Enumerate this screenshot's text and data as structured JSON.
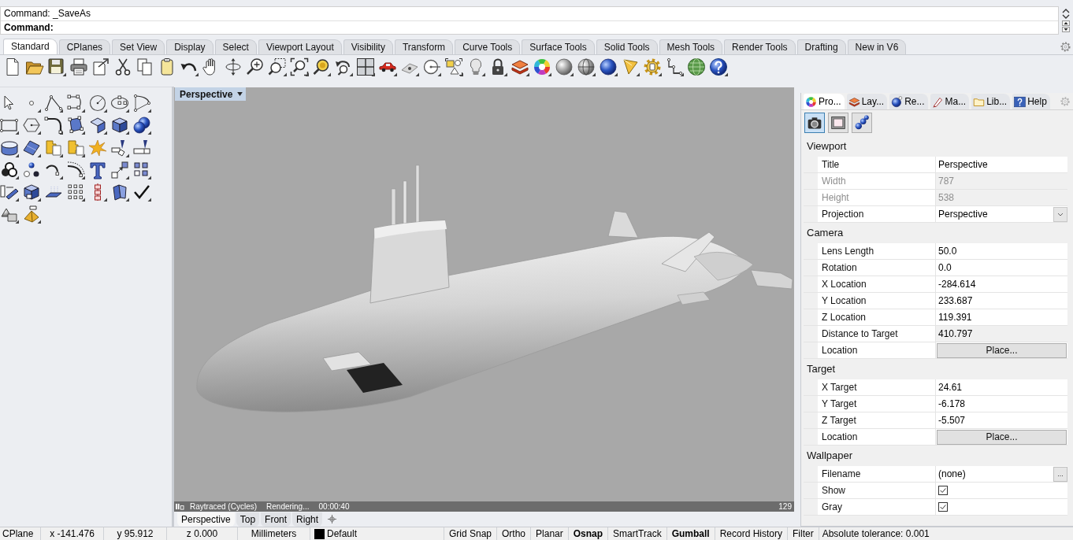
{
  "command_area": {
    "history_line": "Command: _SaveAs",
    "prompt": "Command:"
  },
  "ribbon_tabs": [
    {
      "label": "Standard",
      "selected": true
    },
    {
      "label": "CPlanes",
      "selected": false
    },
    {
      "label": "Set View",
      "selected": false
    },
    {
      "label": "Display",
      "selected": false
    },
    {
      "label": "Select",
      "selected": false
    },
    {
      "label": "Viewport Layout",
      "selected": false
    },
    {
      "label": "Visibility",
      "selected": false
    },
    {
      "label": "Transform",
      "selected": false
    },
    {
      "label": "Curve Tools",
      "selected": false
    },
    {
      "label": "Surface Tools",
      "selected": false
    },
    {
      "label": "Solid Tools",
      "selected": false
    },
    {
      "label": "Mesh Tools",
      "selected": false
    },
    {
      "label": "Render Tools",
      "selected": false
    },
    {
      "label": "Drafting",
      "selected": false
    },
    {
      "label": "New in V6",
      "selected": false
    }
  ],
  "viewport": {
    "title": "Perspective",
    "render_status": {
      "mode": "Raytraced (Cycles)",
      "state": "Rendering...",
      "time": "00:00:40",
      "passes": "129"
    },
    "tabs": [
      {
        "label": "Perspective",
        "selected": true
      },
      {
        "label": "Top",
        "selected": false
      },
      {
        "label": "Front",
        "selected": false
      },
      {
        "label": "Right",
        "selected": false
      }
    ]
  },
  "properties_panel": {
    "tabs": [
      {
        "label": "Pro...",
        "selected": true
      },
      {
        "label": "Lay...",
        "selected": false
      },
      {
        "label": "Re...",
        "selected": false
      },
      {
        "label": "Ma...",
        "selected": false
      },
      {
        "label": "Lib...",
        "selected": false
      },
      {
        "label": "Help",
        "selected": false
      }
    ],
    "page_buttons": [
      {
        "selected": true
      },
      {
        "selected": false
      },
      {
        "selected": false
      }
    ],
    "sections": [
      {
        "title": "Viewport",
        "rows": [
          {
            "label": "Title",
            "kind": "text",
            "value": "Perspective",
            "disabled": false
          },
          {
            "label": "Width",
            "kind": "text",
            "value": "787",
            "disabled": true
          },
          {
            "label": "Height",
            "kind": "text",
            "value": "538",
            "disabled": true
          },
          {
            "label": "Projection",
            "kind": "dropdown",
            "value": "Perspective",
            "disabled": false
          }
        ]
      },
      {
        "title": "Camera",
        "rows": [
          {
            "label": "Lens Length",
            "kind": "text",
            "value": "50.0",
            "disabled": false
          },
          {
            "label": "Rotation",
            "kind": "text",
            "value": "0.0",
            "disabled": false
          },
          {
            "label": "X Location",
            "kind": "text",
            "value": "-284.614",
            "disabled": false
          },
          {
            "label": "Y Location",
            "kind": "text",
            "value": "233.687",
            "disabled": false
          },
          {
            "label": "Z Location",
            "kind": "text",
            "value": "119.391",
            "disabled": false
          },
          {
            "label": "Distance to Target",
            "kind": "readonly",
            "value": "410.797",
            "disabled": false
          },
          {
            "label": "Location",
            "kind": "button",
            "value": "Place...",
            "disabled": false
          }
        ]
      },
      {
        "title": "Target",
        "rows": [
          {
            "label": "X Target",
            "kind": "text",
            "value": "24.61",
            "disabled": false
          },
          {
            "label": "Y Target",
            "kind": "text",
            "value": "-6.178",
            "disabled": false
          },
          {
            "label": "Z Target",
            "kind": "text",
            "value": "-5.507",
            "disabled": false
          },
          {
            "label": "Location",
            "kind": "button",
            "value": "Place...",
            "disabled": false
          }
        ]
      },
      {
        "title": "Wallpaper",
        "rows": [
          {
            "label": "Filename",
            "kind": "browse",
            "value": "(none)",
            "button_label": "...",
            "disabled": false
          },
          {
            "label": "Show",
            "kind": "checkbox",
            "checked": true,
            "disabled": false
          },
          {
            "label": "Gray",
            "kind": "checkbox",
            "checked": true,
            "disabled": false
          }
        ]
      }
    ]
  },
  "status_bar": {
    "cplane": "CPlane",
    "x": "x -141.476",
    "y": "y 95.912",
    "z": "z 0.000",
    "units": "Millimeters",
    "layer": {
      "name": "Default",
      "color": "#000000"
    },
    "toggles": [
      {
        "label": "Grid Snap",
        "on": false
      },
      {
        "label": "Ortho",
        "on": false
      },
      {
        "label": "Planar",
        "on": false
      },
      {
        "label": "Osnap",
        "on": true
      },
      {
        "label": "SmartTrack",
        "on": false
      },
      {
        "label": "Gumball",
        "on": true
      },
      {
        "label": "Record History",
        "on": false
      },
      {
        "label": "Filter",
        "on": false
      }
    ],
    "tolerance": "Absolute tolerance: 0.001"
  }
}
